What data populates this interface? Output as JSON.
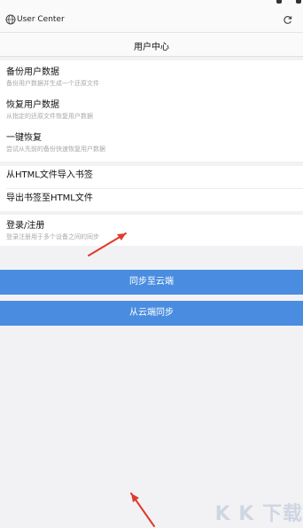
{
  "browser": {
    "url": "User Center"
  },
  "page": {
    "title": "用户中心"
  },
  "sections": {
    "backup_group": [
      {
        "title": "备份用户数据",
        "subtitle": "备份用户数据并生成一个还原文件"
      },
      {
        "title": "恢复用户数据",
        "subtitle": "从指定的还原文件恢复用户数据"
      },
      {
        "title": "一键恢复",
        "subtitle": "尝试从先前的备份快速恢复用户数据"
      }
    ],
    "bookmark_group": [
      {
        "title": "从HTML文件导入书签"
      },
      {
        "title": "导出书签至HTML文件"
      }
    ],
    "account_group": [
      {
        "title": "登录/注册",
        "subtitle": "登录注册用于多个设备之间的同步"
      }
    ]
  },
  "buttons": {
    "sync_to_cloud": "同步至云端",
    "sync_from_cloud": "从云端同步"
  },
  "colors": {
    "accent": "#4a8de0",
    "annotation_arrow": "#e03a2a"
  },
  "icons": {
    "globe": "globe-icon",
    "reload": "reload-icon"
  },
  "watermark": "K K 下载"
}
